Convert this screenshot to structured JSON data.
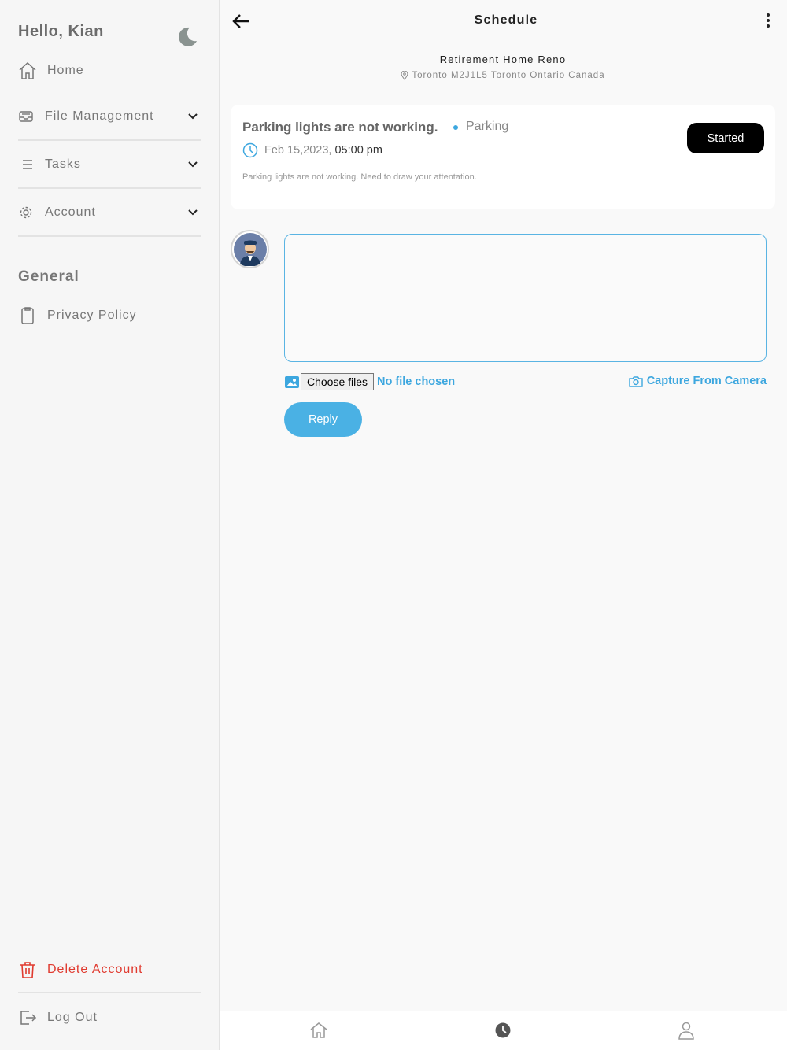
{
  "sidebar": {
    "greeting": "Hello, Kian",
    "home_label": "Home",
    "items": [
      {
        "label": "File Management",
        "icon": "inbox-icon"
      },
      {
        "label": "Tasks",
        "icon": "list-icon"
      },
      {
        "label": "Account",
        "icon": "gear-icon"
      }
    ],
    "general_title": "General",
    "privacy_label": "Privacy Policy",
    "delete_label": "Delete Account",
    "logout_label": "Log Out"
  },
  "header": {
    "title": "Schedule",
    "project_name": "Retirement Home Reno",
    "address": "Toronto M2J1L5 Toronto Ontario Canada"
  },
  "issue": {
    "title": "Parking lights are not working.",
    "category": "Parking",
    "date": "Feb 15,2023,",
    "time": "05:00 pm",
    "description": "Parking lights are not working. Need to draw your attentation.",
    "status": "Started"
  },
  "reply": {
    "choose_files_label": "Choose files",
    "no_file_label": "No file chosen",
    "camera_label": "Capture From Camera",
    "reply_button": "Reply"
  },
  "colors": {
    "accent": "#3da7df",
    "danger": "#e03a2f",
    "status_bg": "#000000"
  }
}
